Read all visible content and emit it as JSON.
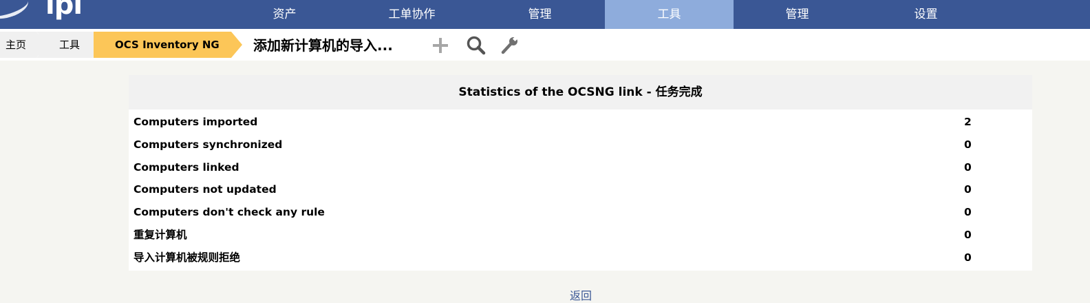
{
  "logo": {
    "text": "lpi"
  },
  "nav": {
    "items": [
      {
        "label": "资产",
        "active": false
      },
      {
        "label": "工单协作",
        "active": false
      },
      {
        "label": "管理",
        "active": false
      },
      {
        "label": "工具",
        "active": true
      },
      {
        "label": "管理",
        "active": false
      },
      {
        "label": "设置",
        "active": false
      }
    ]
  },
  "breadcrumb": {
    "home": "主页",
    "tools": "工具",
    "current": "OCS Inventory NG"
  },
  "page": {
    "title": "添加新计算机的导入...",
    "icons": [
      "add-icon",
      "search-icon",
      "wrench-icon"
    ]
  },
  "stats": {
    "title": "Statistics of the OCSNG link - 任务完成",
    "rows": [
      {
        "label": "Computers imported",
        "value": "2"
      },
      {
        "label": "Computers synchronized",
        "value": "0"
      },
      {
        "label": "Computers linked",
        "value": "0"
      },
      {
        "label": "Computers not updated",
        "value": "0"
      },
      {
        "label": "Computers don't check any rule",
        "value": "0"
      },
      {
        "label": "重复计算机",
        "value": "0"
      },
      {
        "label": "导入计算机被规则拒绝",
        "value": "0"
      }
    ]
  },
  "back_link": "返回",
  "colors": {
    "nav_bg": "#3a5795",
    "nav_active": "#8eacdc",
    "breadcrumb_current": "#fcc658",
    "page_bg": "#f5f5f1"
  }
}
